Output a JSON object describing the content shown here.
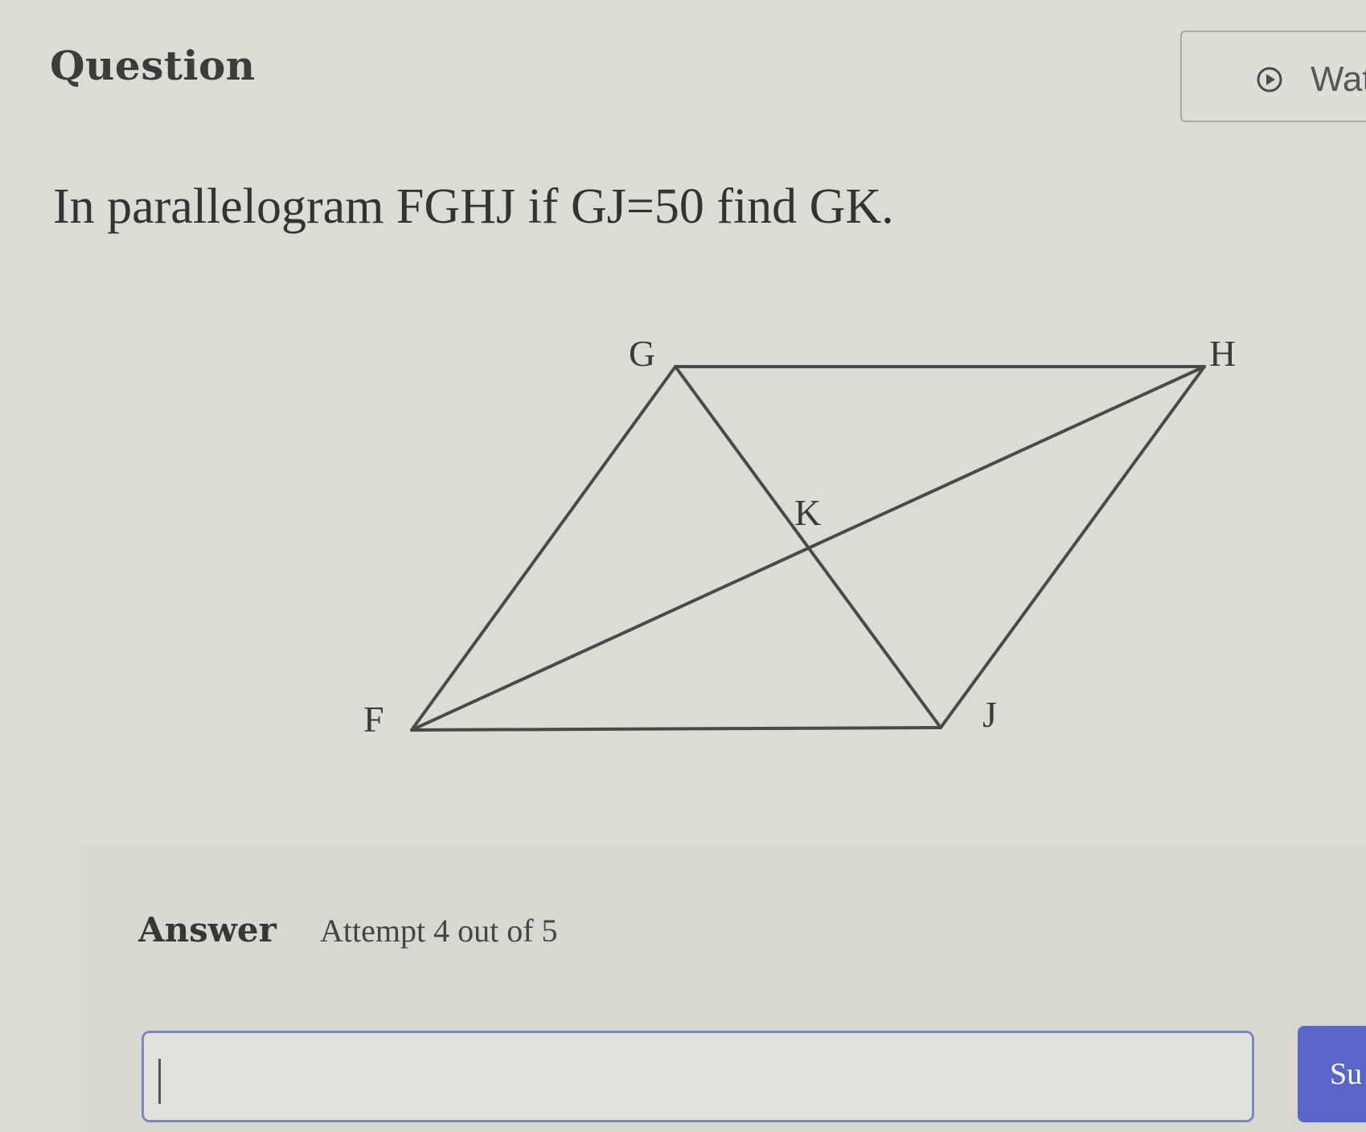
{
  "header": {
    "title": "Question",
    "watch_button_label": "Wat",
    "watch_icon": "play-circle-icon"
  },
  "question": {
    "prompt": "In parallelogram FGHJ if GJ=50 find GK."
  },
  "figure": {
    "vertices": {
      "G": "G",
      "H": "H",
      "J": "J",
      "F": "F",
      "K": "K"
    }
  },
  "answer": {
    "label": "Answer",
    "attempt_text": "Attempt 4 out of 5",
    "input_value": "",
    "submit_label": "Su"
  },
  "colors": {
    "background": "#dcdcd4",
    "submit": "#5766c8",
    "input_border": "#7b86c6",
    "figure_lines": "#4a4a4a"
  }
}
